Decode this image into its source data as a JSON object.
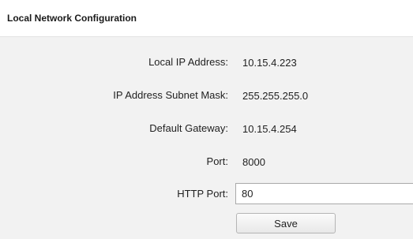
{
  "panel": {
    "title": "Local Network Configuration"
  },
  "fields": {
    "local_ip": {
      "label": "Local IP Address:",
      "value": "10.15.4.223"
    },
    "subnet_mask": {
      "label": "IP Address Subnet Mask:",
      "value": "255.255.255.0"
    },
    "gateway": {
      "label": "Default Gateway:",
      "value": "10.15.4.254"
    },
    "port": {
      "label": "Port:",
      "value": "8000"
    },
    "http_port": {
      "label": "HTTP Port:",
      "value": "80"
    }
  },
  "actions": {
    "save_label": "Save"
  }
}
